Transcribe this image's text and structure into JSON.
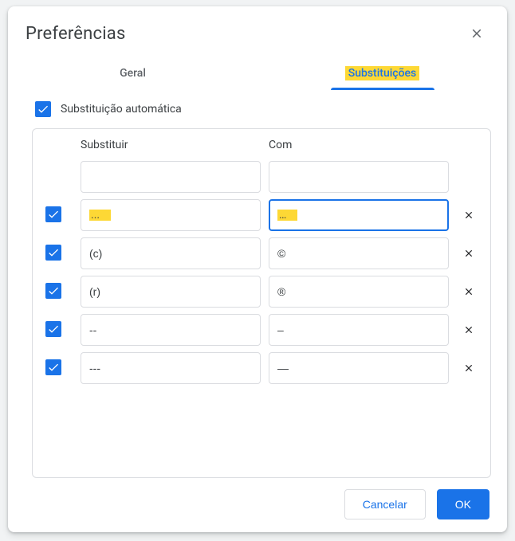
{
  "title": "Preferências",
  "tabs": {
    "general": "Geral",
    "subs": "Substituições"
  },
  "active_tab": "subs",
  "auto_sub_label": "Substituição automática",
  "auto_sub_checked": true,
  "headers": {
    "replace": "Substituir",
    "with": "Com"
  },
  "rows": [
    {
      "checked": null,
      "replace": "",
      "with": "",
      "focused": null,
      "highlight": false
    },
    {
      "checked": true,
      "replace": "...",
      "with": "…",
      "focused": "with",
      "highlight": true
    },
    {
      "checked": true,
      "replace": "(c)",
      "with": "©",
      "focused": null,
      "highlight": false
    },
    {
      "checked": true,
      "replace": "(r)",
      "with": "®",
      "focused": null,
      "highlight": false
    },
    {
      "checked": true,
      "replace": "--",
      "with": "–",
      "focused": null,
      "highlight": false
    },
    {
      "checked": true,
      "replace": "---",
      "with": "—",
      "focused": null,
      "highlight": false
    }
  ],
  "buttons": {
    "cancel": "Cancelar",
    "ok": "OK"
  }
}
